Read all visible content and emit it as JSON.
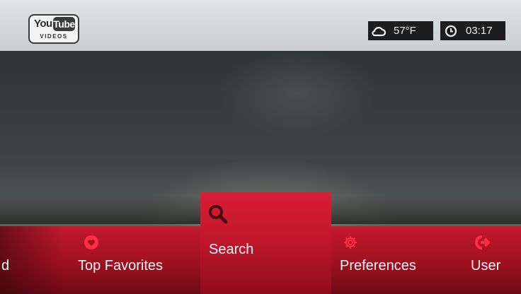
{
  "app": {
    "logo": {
      "you": "You",
      "tube": "Tube",
      "sub": "VIDEOS"
    }
  },
  "status": {
    "temperature": "57°F",
    "time": "03:17"
  },
  "menu": {
    "items": [
      {
        "label": "d",
        "icon": "partial"
      },
      {
        "label": "Top Favorites",
        "icon": "heart-icon"
      },
      {
        "label": "Search",
        "icon": "search-icon",
        "selected": true
      },
      {
        "label": "Preferences",
        "icon": "gear-icon"
      },
      {
        "label": "User",
        "icon": "sign-out-icon"
      }
    ]
  },
  "colors": {
    "menu_red": "#b3162a",
    "selected_red": "#d81e34",
    "icon_red": "#ff2d46",
    "topbar": "#d6d9da",
    "status_bg": "#1d1d1d"
  }
}
